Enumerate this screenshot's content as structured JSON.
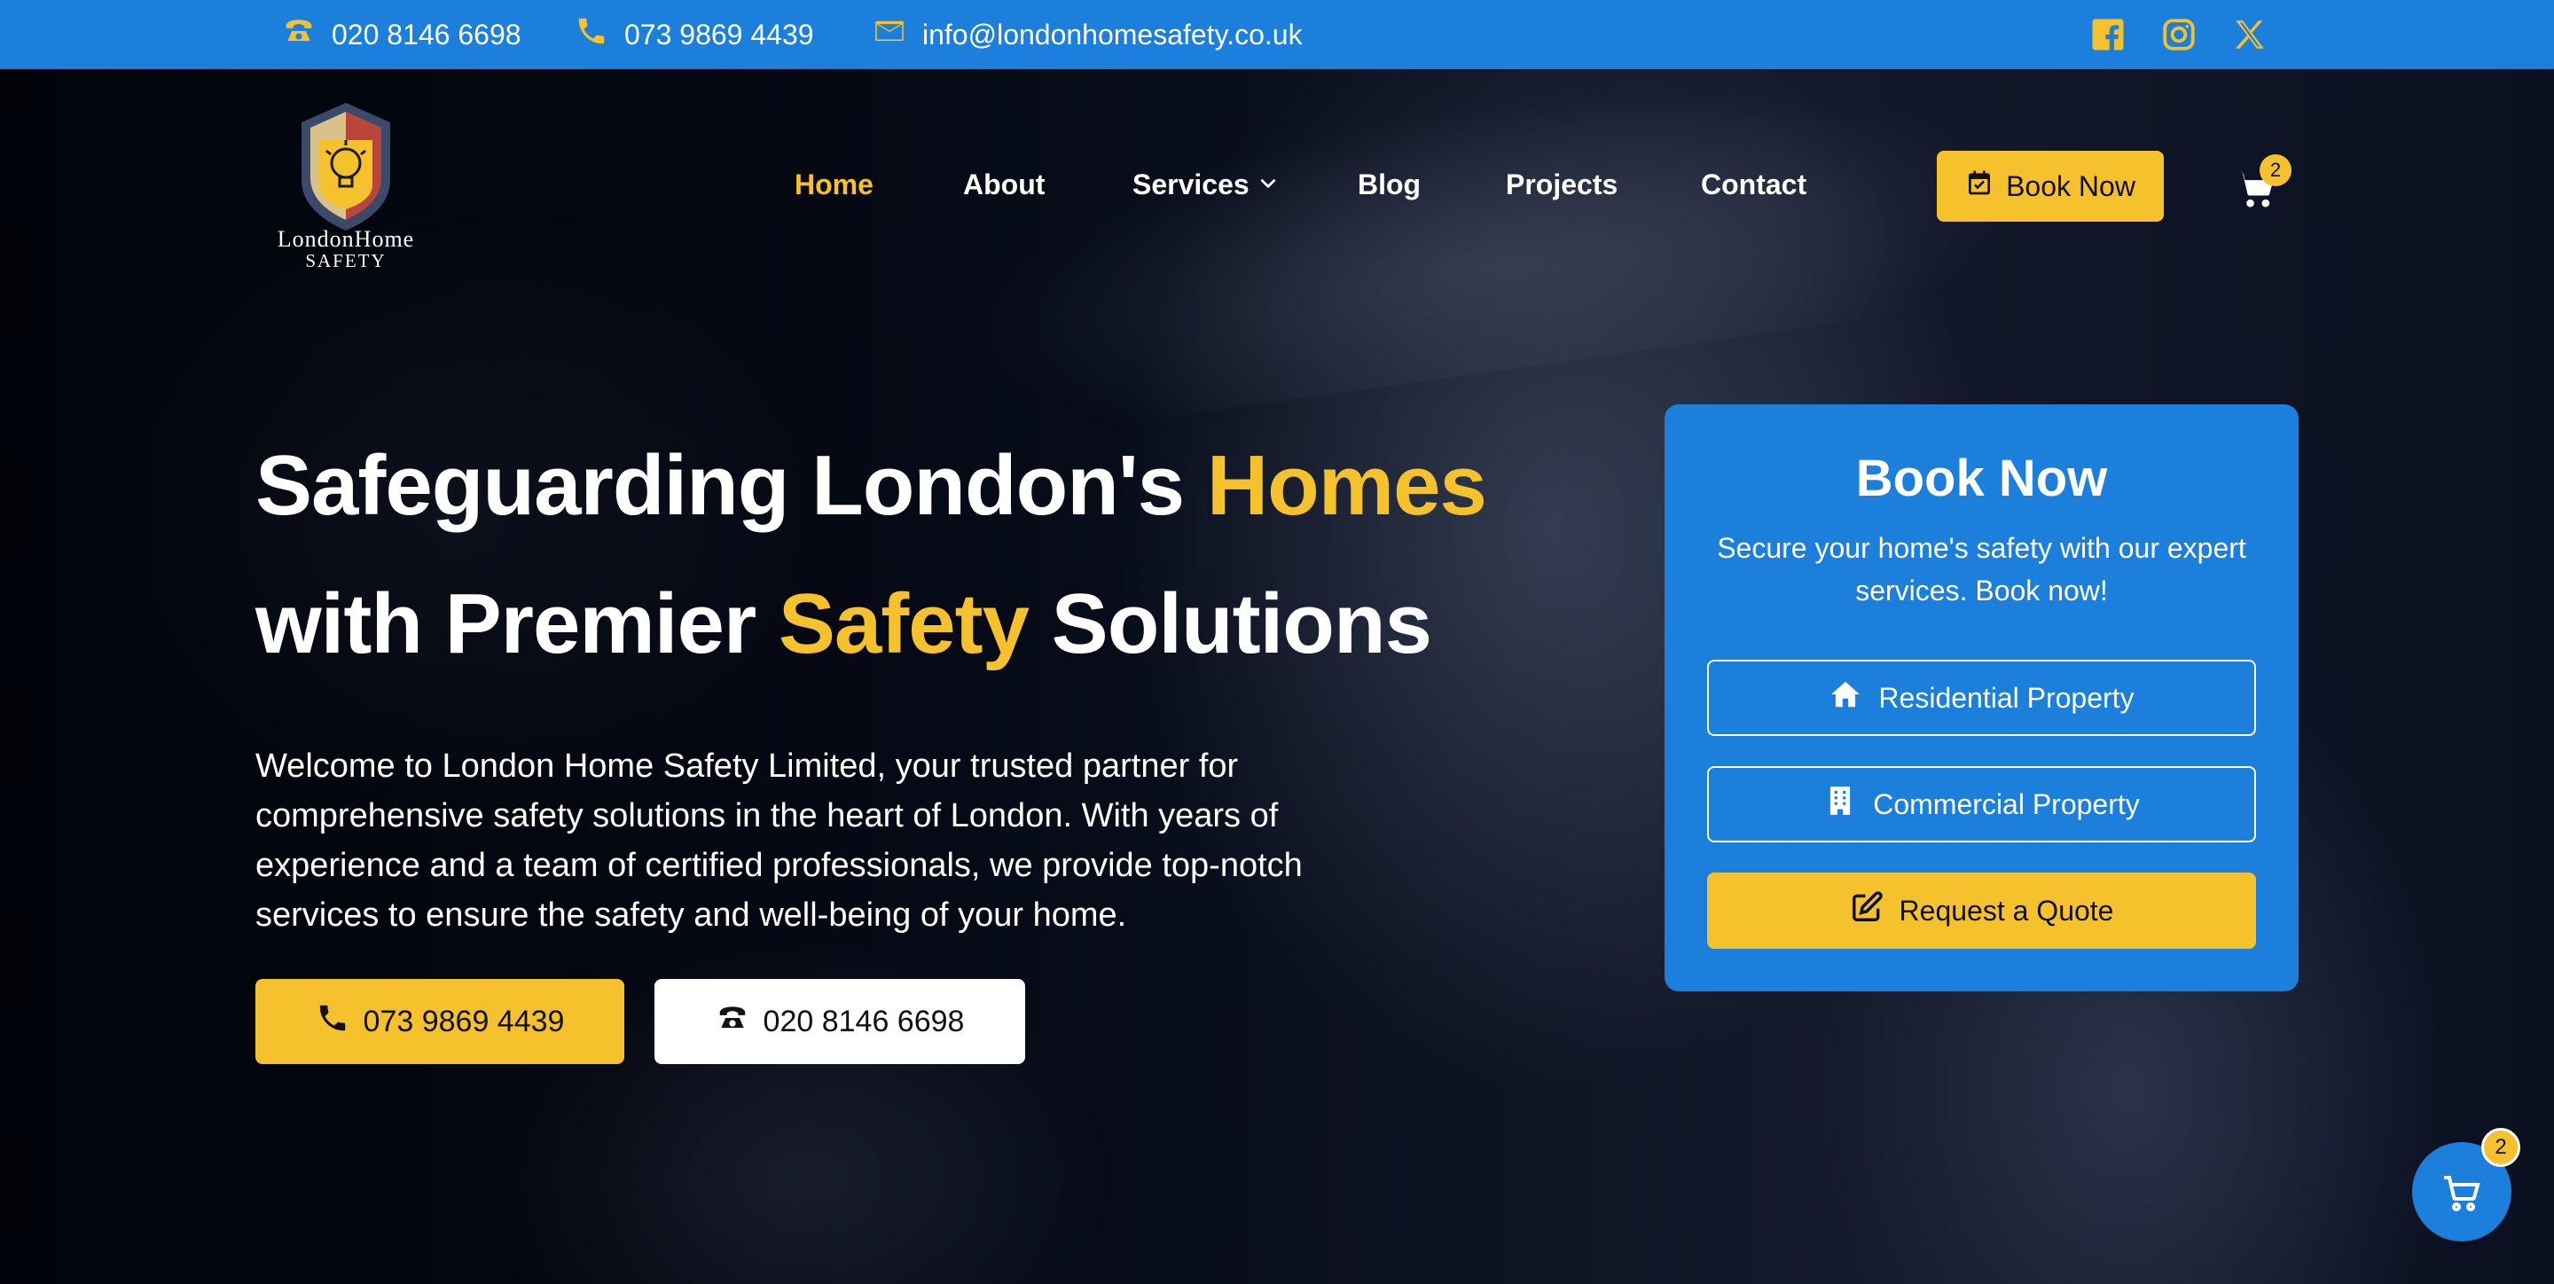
{
  "topbar": {
    "phone1": "020 8146 6698",
    "phone2": "073 9869 4439",
    "email": "info@londonhomesafety.co.uk",
    "icons": {
      "phone1": "telephone-icon",
      "phone2": "phone-icon",
      "email": "envelope-icon",
      "social": [
        "facebook-icon",
        "instagram-icon",
        "x-icon"
      ]
    }
  },
  "logo": {
    "line1": "LondonHome",
    "line2": "SAFETY"
  },
  "nav": {
    "items": [
      {
        "label": "Home",
        "active": true
      },
      {
        "label": "About"
      },
      {
        "label": "Services",
        "dropdown": true
      },
      {
        "label": "Blog"
      },
      {
        "label": "Projects"
      },
      {
        "label": "Contact"
      }
    ],
    "book_label": "Book Now",
    "cart_count": "2"
  },
  "hero": {
    "title_line1_part1": "Safeguarding London's ",
    "title_line1_accent": "Homes",
    "title_line2_part1": "with Premier ",
    "title_line2_accent": "Safety",
    "title_line2_part2": " Solutions",
    "description": "Welcome to London Home Safety Limited, your trusted partner for comprehensive safety solutions in the heart of London. With years of experience and a team of certified professionals, we provide top-notch services to ensure the safety and well-being of your home.",
    "cta_primary": "073 9869 4439",
    "cta_secondary": "020 8146 6698"
  },
  "card": {
    "title": "Book Now",
    "subtitle": "Secure your home's safety with our expert services. Book now!",
    "residential": "Residential Property",
    "commercial": "Commercial Property",
    "quote": "Request a Quote"
  },
  "float_cart": {
    "count": "2"
  },
  "colors": {
    "accent": "#f5c22e",
    "brand_blue": "#1c7fdc",
    "dark": "#05070f"
  }
}
